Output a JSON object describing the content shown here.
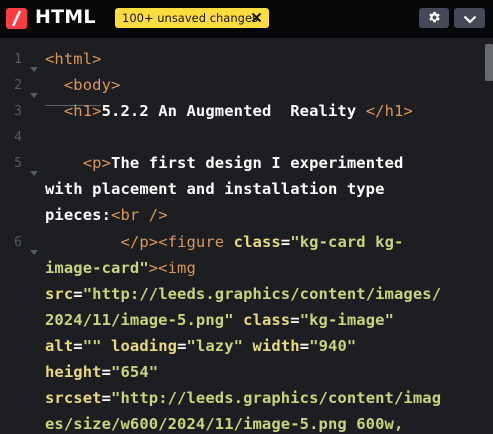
{
  "header": {
    "title": "HTML",
    "badge": "100+ unsaved changes",
    "icons": [
      "logo-icon",
      "close-icon",
      "gear-icon",
      "chevron-down-icon"
    ]
  },
  "gutter": {
    "lines": [
      "1",
      "2",
      "3",
      "4",
      "5",
      "6"
    ]
  },
  "code": {
    "l1": "<html>",
    "l2": "<body>",
    "l3_open": "<h1>",
    "l3_text": "5.2.2 An Augmented  Reality ",
    "l3_close": "</h1>",
    "l5_open": "<p>",
    "l5_text": "The first design I experimented",
    "l5b": "with placement and installation type",
    "l5c_text": "pieces:",
    "l5c_tag": "<br />",
    "l6_close": "</p>",
    "l6_fig": "<figure ",
    "l6_class": "class",
    "l6_eq": "=",
    "l6_val": "\"kg-card kg-",
    "l6b_val": "image-card\"",
    "l6b_img": "><img",
    "l6c_attr": "src",
    "l6c_eq": "=",
    "l6c_val": "\"http://leeds.graphics/content/images/",
    "l6d_val": "2024/11/image-5.png\"",
    "l6d_attr": "class",
    "l6d_eq": "=",
    "l6d_val2": "\"kg-image\"",
    "l6e_attr": "alt",
    "l6e_eq": "=",
    "l6e_val": "\"\"",
    "l6e_attr2": "loading",
    "l6e_val2": "\"lazy\"",
    "l6e_attr3": "width",
    "l6e_val3": "\"940\"",
    "l6f_attr": "height",
    "l6f_eq": "=",
    "l6f_val": "\"654\"",
    "l6g_attr": "srcset",
    "l6g_eq": "=",
    "l6g_val": "\"http://leeds.graphics/content/imag",
    "l6h_val": "es/size/w600/2024/11/image-5.png 600w,"
  },
  "colors": {
    "tag": "#dc9656",
    "attr": "#e8d87f",
    "string": "#c5d67c",
    "text": "#ffffff",
    "badge": "#ffdd40",
    "logo": "#ff3c41"
  }
}
